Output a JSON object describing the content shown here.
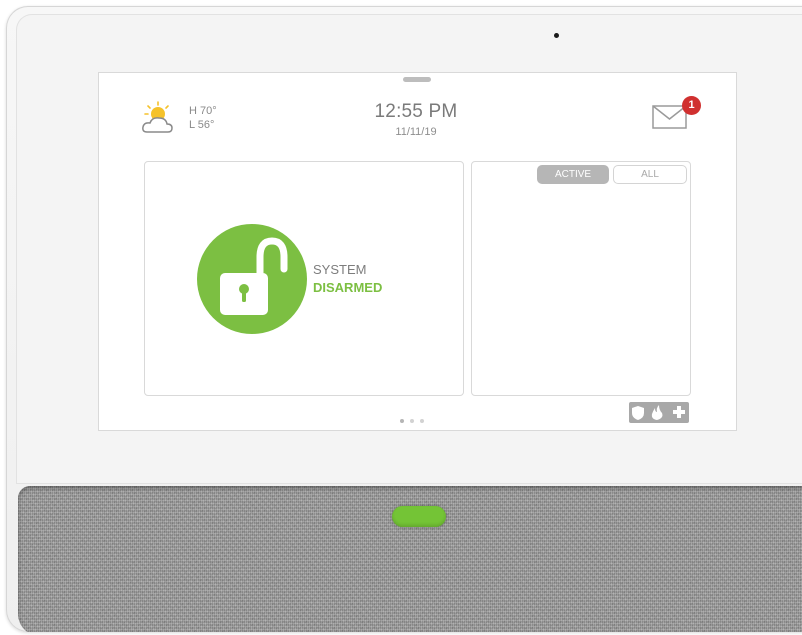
{
  "weather": {
    "icon": "partly-cloudy-icon",
    "high": "H 70°",
    "low": "L 56°"
  },
  "clock": {
    "time": "12:55 PM",
    "date": "11/11/19"
  },
  "messages": {
    "icon": "envelope-icon",
    "badge_count": "1",
    "badge_color": "#d0302f"
  },
  "system_status": {
    "icon": "unlocked-padlock-icon",
    "line1": "SYSTEM",
    "line2": "DISARMED",
    "accent_color": "#7cbf42"
  },
  "sensor_tabs": {
    "active_label": "ACTIVE",
    "all_label": "ALL",
    "selected": "ACTIVE"
  },
  "page_indicator": {
    "pages": 3,
    "current": 1
  },
  "emergency_button": {
    "icons": [
      "shield-icon",
      "fire-icon",
      "medical-cross-icon"
    ]
  },
  "home_button": {
    "color": "#74c436"
  }
}
